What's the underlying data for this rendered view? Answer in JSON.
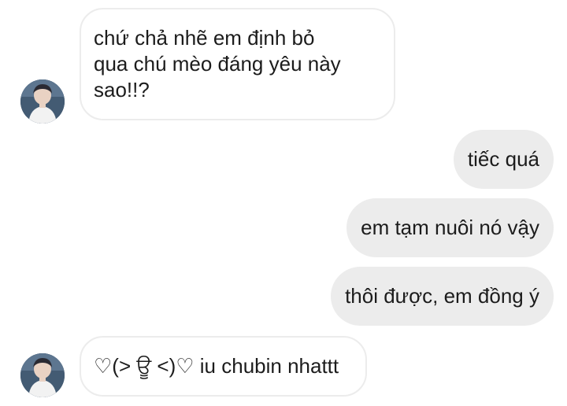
{
  "conversation": {
    "messages": [
      {
        "sender": "contact",
        "text": "chứ chả nhẽ em định bỏ\nqua chú mèo đáng yêu này\nsao!!?"
      },
      {
        "sender": "me",
        "text": "tiếc quá"
      },
      {
        "sender": "me",
        "text": "em tạm nuôi nó vậy"
      },
      {
        "sender": "me",
        "text": "thôi được, em đồng ý"
      },
      {
        "sender": "contact",
        "text": "♡(> ਊ <)♡ iu chubin nhattt"
      }
    ]
  },
  "colors": {
    "incoming_bubble": "#ffffff",
    "incoming_border": "#ececec",
    "outgoing_bubble": "#ececec",
    "text": "#1c1c1c"
  }
}
